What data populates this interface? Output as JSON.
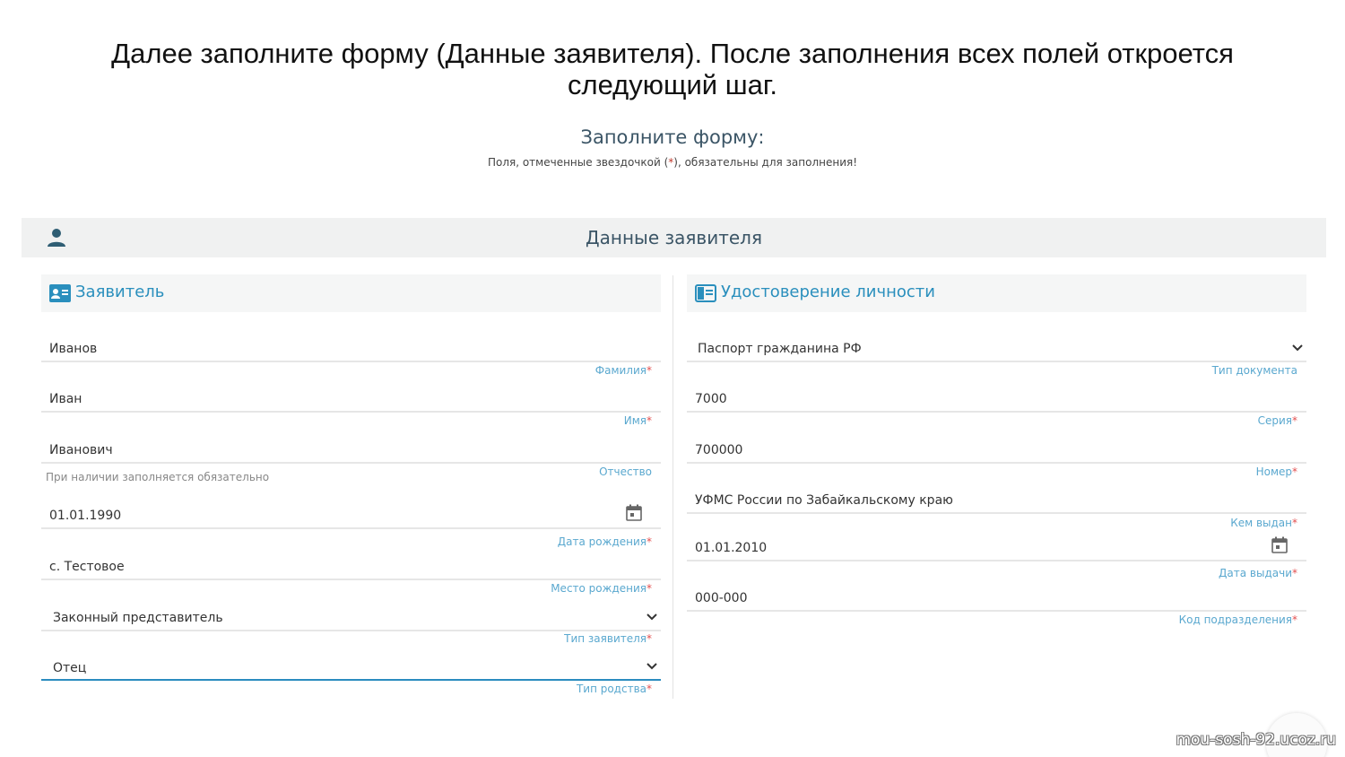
{
  "slide": {
    "instruction_line1": "Далее заполните форму (Данные заявителя). После заполнения всех полей откроется",
    "instruction_line2": "следующий шаг."
  },
  "form": {
    "heading": "Заполните форму:",
    "note_before": "Поля, отмеченные звездочкой (",
    "note_star": "*",
    "note_after": "), обязательны для заполнения!"
  },
  "section": {
    "title": "Данные заявителя",
    "icon": "person-icon"
  },
  "applicant": {
    "title": "Заявитель",
    "icon": "id-card-icon",
    "fields": {
      "last_name": {
        "value": "Иванов",
        "label": "Фамилия",
        "required": "*"
      },
      "first_name": {
        "value": "Иван",
        "label": "Имя",
        "required": "*"
      },
      "patronymic": {
        "value": "Иванович",
        "label": "Отчество",
        "hint": "При наличии заполняется обязательно"
      },
      "birth_date": {
        "value": "01.01.1990",
        "label": "Дата рождения",
        "required": "*"
      },
      "birth_place": {
        "value": "с. Тестовое",
        "label": "Место рождения",
        "required": "*"
      },
      "applicant_type": {
        "value": "Законный представитель",
        "label": "Тип заявителя",
        "required": "*"
      },
      "relation_type": {
        "value": "Отец",
        "label": "Тип родства",
        "required": "*"
      }
    }
  },
  "identity": {
    "title": "Удостоверение личности",
    "icon": "document-icon",
    "fields": {
      "doc_type": {
        "value": "Паспорт гражданина РФ",
        "label": "Тип документа"
      },
      "series": {
        "value": "7000",
        "label": "Серия",
        "required": "*"
      },
      "number": {
        "value": "700000",
        "label": "Номер",
        "required": "*"
      },
      "issued_by": {
        "value": "УФМС России по Забайкальскому краю",
        "label": "Кем выдан",
        "required": "*"
      },
      "issue_date": {
        "value": "01.01.2010",
        "label": "Дата выдачи",
        "required": "*"
      },
      "division_code": {
        "value": "000-000",
        "label": "Код подразделения",
        "required": "*"
      }
    }
  },
  "watermark": "mou-sosh-92.ucoz.ru",
  "colors": {
    "accent": "#2b8cbf",
    "label": "#5aa8cf",
    "required": "#e35050",
    "heading": "#3b5566",
    "section_bg": "#f0f1f1"
  }
}
